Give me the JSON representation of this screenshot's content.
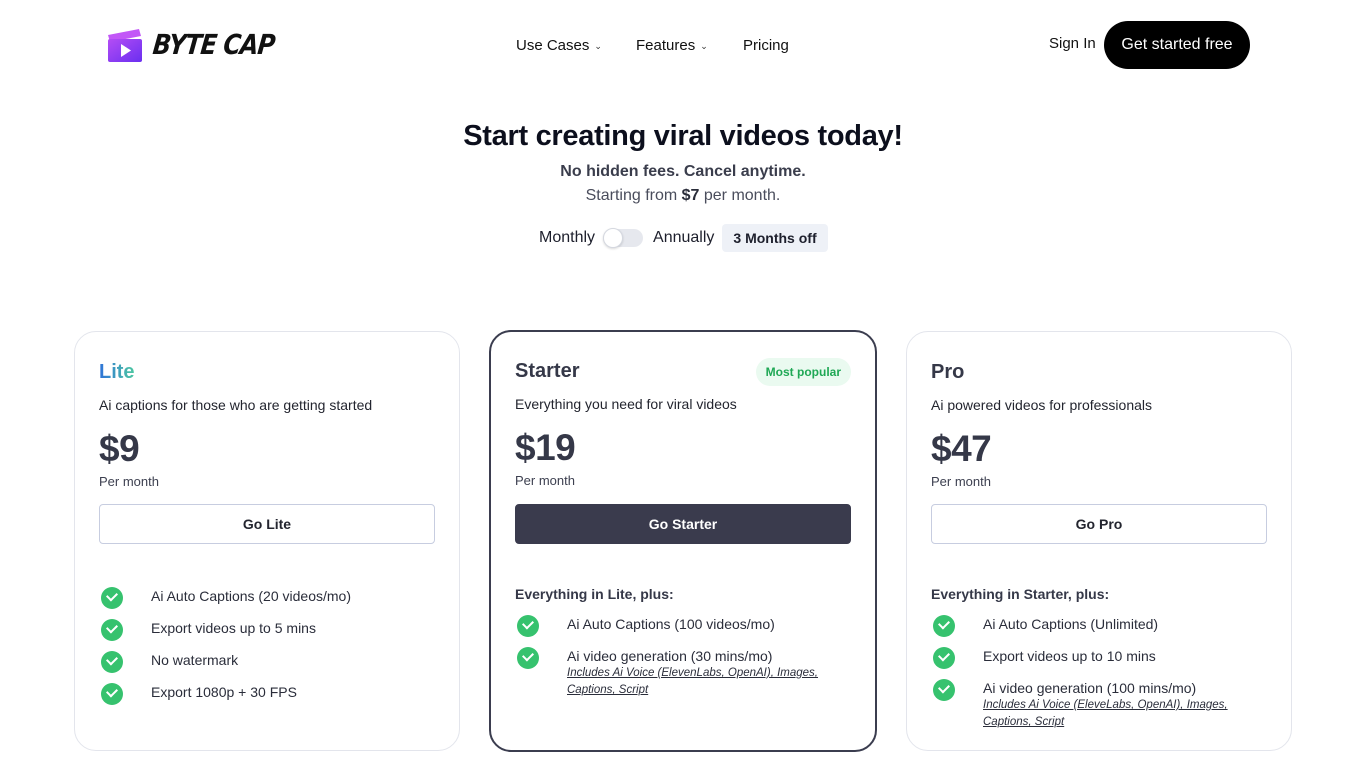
{
  "brand": {
    "name": "BYTE CAP",
    "logo_icon": "play-clapper-logo"
  },
  "nav": {
    "use_cases": "Use Cases",
    "features": "Features",
    "pricing": "Pricing",
    "chevron": "⌄"
  },
  "header": {
    "sign_in": "Sign In",
    "cta": "Get started free"
  },
  "hero": {
    "title": "Start creating viral videos today!",
    "subtitle": "No hidden fees. Cancel anytime.",
    "starting_prefix": "Starting from ",
    "starting_price": "$7",
    "starting_suffix": " per month."
  },
  "billing": {
    "monthly": "Monthly",
    "annually": "Annually",
    "discount": "3 Months off",
    "annual_selected": false
  },
  "plans": [
    {
      "name": "Lite",
      "desc": "Ai captions for those who are getting started",
      "price": "$9",
      "period": "Per month",
      "button": "Go Lite",
      "features": [
        {
          "text": "Ai Auto Captions (20 videos/mo)"
        },
        {
          "text": "Export videos up to 5 mins"
        },
        {
          "text": "No watermark"
        },
        {
          "text": "Export 1080p + 30 FPS"
        }
      ]
    },
    {
      "name": "Starter",
      "badge": "Most popular",
      "desc": "Everything you need for viral videos",
      "price": "$19",
      "period": "Per month",
      "button": "Go Starter",
      "includes": "Everything in Lite, plus:",
      "features": [
        {
          "text": "Ai Auto Captions (100 videos/mo)"
        },
        {
          "text": "Ai video generation (30 mins/mo)",
          "note": "Includes Ai Voice (ElevenLabs, OpenAI), Images, Captions, Script"
        }
      ]
    },
    {
      "name": "Pro",
      "desc": "Ai powered videos for professionals",
      "price": "$47",
      "period": "Per month",
      "button": "Go Pro",
      "includes": "Everything in Starter, plus:",
      "features": [
        {
          "text": "Ai Auto Captions (Unlimited)"
        },
        {
          "text": "Export videos up to 10 mins"
        },
        {
          "text": "Ai video generation (100 mins/mo)",
          "note": "Includes Ai Voice (EleveLabs, OpenAI), Images, Captions, Script"
        }
      ]
    }
  ],
  "colors": {
    "check": "#36c26e",
    "cta_bg": "#000000",
    "starter_btn": "#3a3b4d",
    "popular_text": "#1fa855",
    "logo_purple": "#7b3cf0"
  }
}
